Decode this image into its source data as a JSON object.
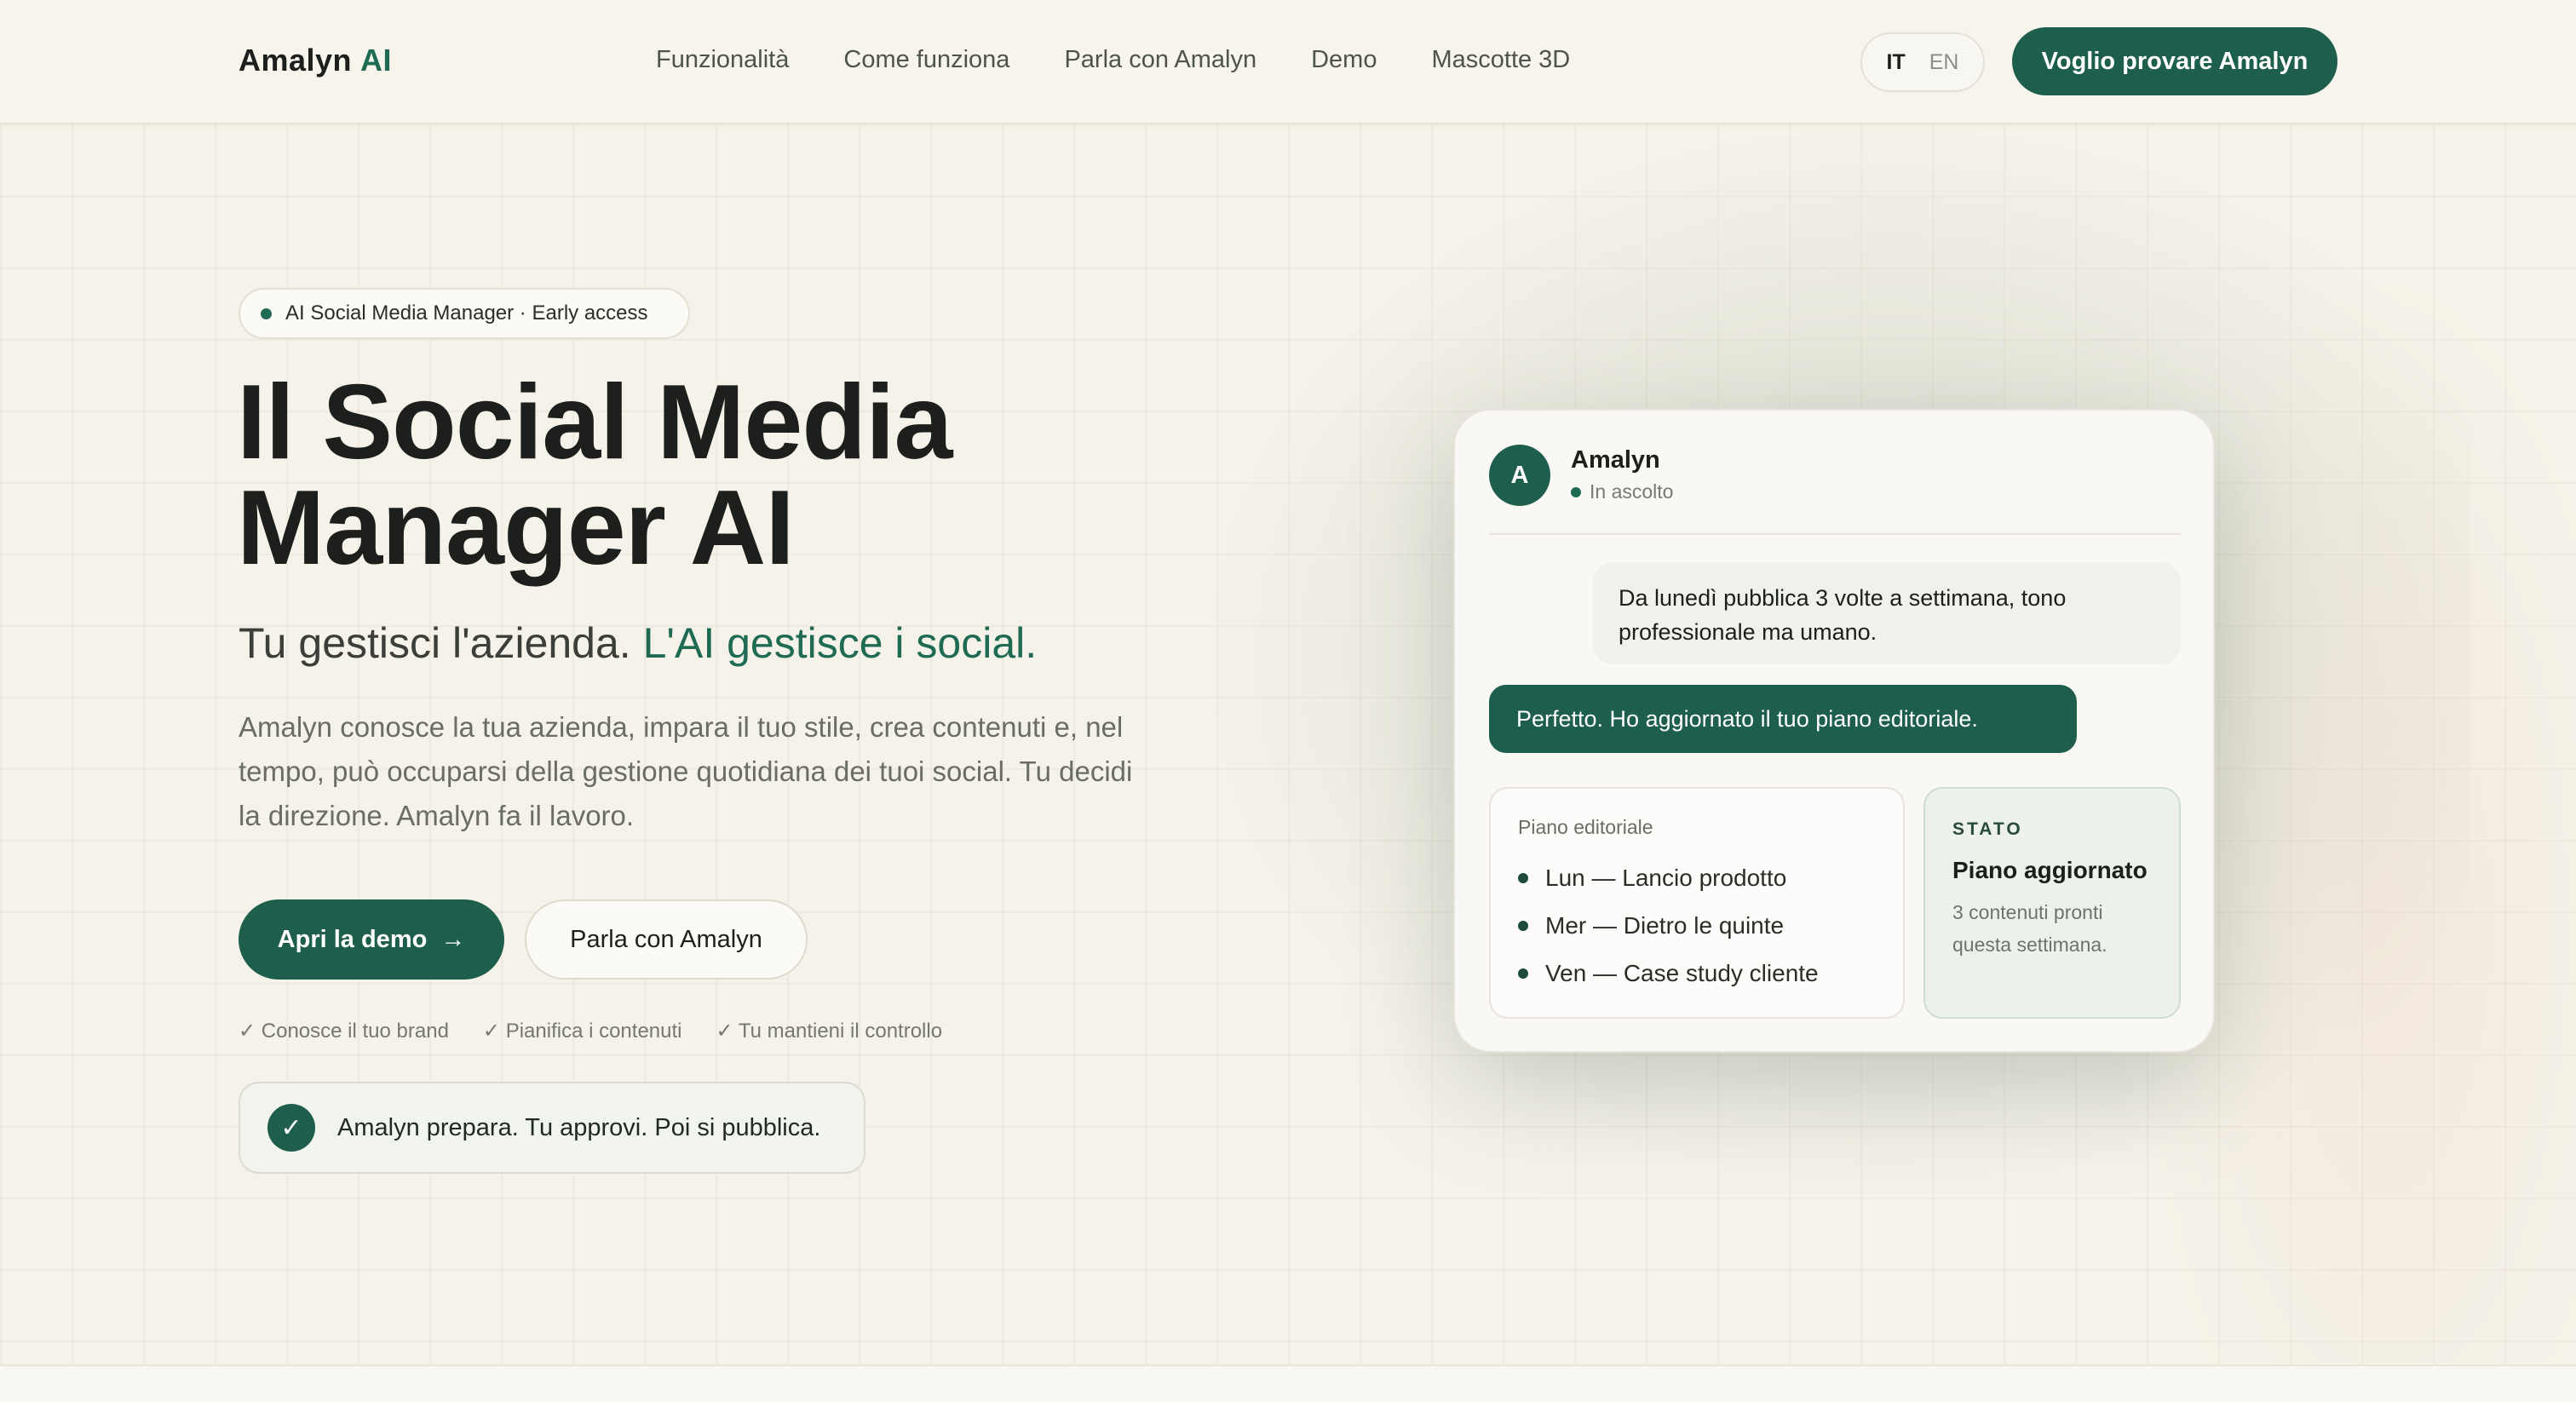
{
  "header": {
    "logo_name": "Amalyn",
    "logo_ai": "AI",
    "nav": [
      "Funzionalità",
      "Come funziona",
      "Parla con Amalyn",
      "Demo",
      "Mascotte 3D"
    ],
    "lang_active": "IT",
    "lang_inactive": "EN",
    "cta": "Voglio provare Amalyn"
  },
  "hero": {
    "badge": "AI Social Media Manager · Early access",
    "title_line1": "Il Social Media",
    "title_line2": "Manager AI",
    "subtitle_plain": "Tu gestisci l'azienda.",
    "subtitle_highlight": "L'AI gestisce i social.",
    "description": "Amalyn conosce la tua azienda, impara il tuo stile, crea contenuti e, nel tempo, può occuparsi della gestione quotidiana dei tuoi social. Tu decidi la direzione. Amalyn fa il lavoro.",
    "primary_button": "Apri la demo",
    "primary_arrow": "→",
    "secondary_button": "Parla con Amalyn",
    "checks": [
      "✓ Conosce il tuo brand",
      "✓ Pianifica i contenuti",
      "✓ Tu mantieni il controllo"
    ],
    "confirm_check": "✓",
    "confirm_text": "Amalyn prepara. Tu approvi. Poi si pubblica."
  },
  "chat": {
    "avatar_letter": "A",
    "name": "Amalyn",
    "status": "In ascolto",
    "user_message": "Da lunedì pubblica 3 volte a settimana, tono professionale ma umano.",
    "bot_message": "Perfetto. Ho aggiornato il tuo piano editoriale.",
    "plan_title": "Piano editoriale",
    "plan_items": [
      "Lun — Lancio prodotto",
      "Mer — Dietro le quinte",
      "Ven — Case study cliente"
    ],
    "state_label": "STATO",
    "state_title": "Piano aggiornato",
    "state_desc": "3 contenuti pronti questa settimana."
  },
  "colors": {
    "accent": "#1e5e4c",
    "background": "#f5f2e9"
  }
}
